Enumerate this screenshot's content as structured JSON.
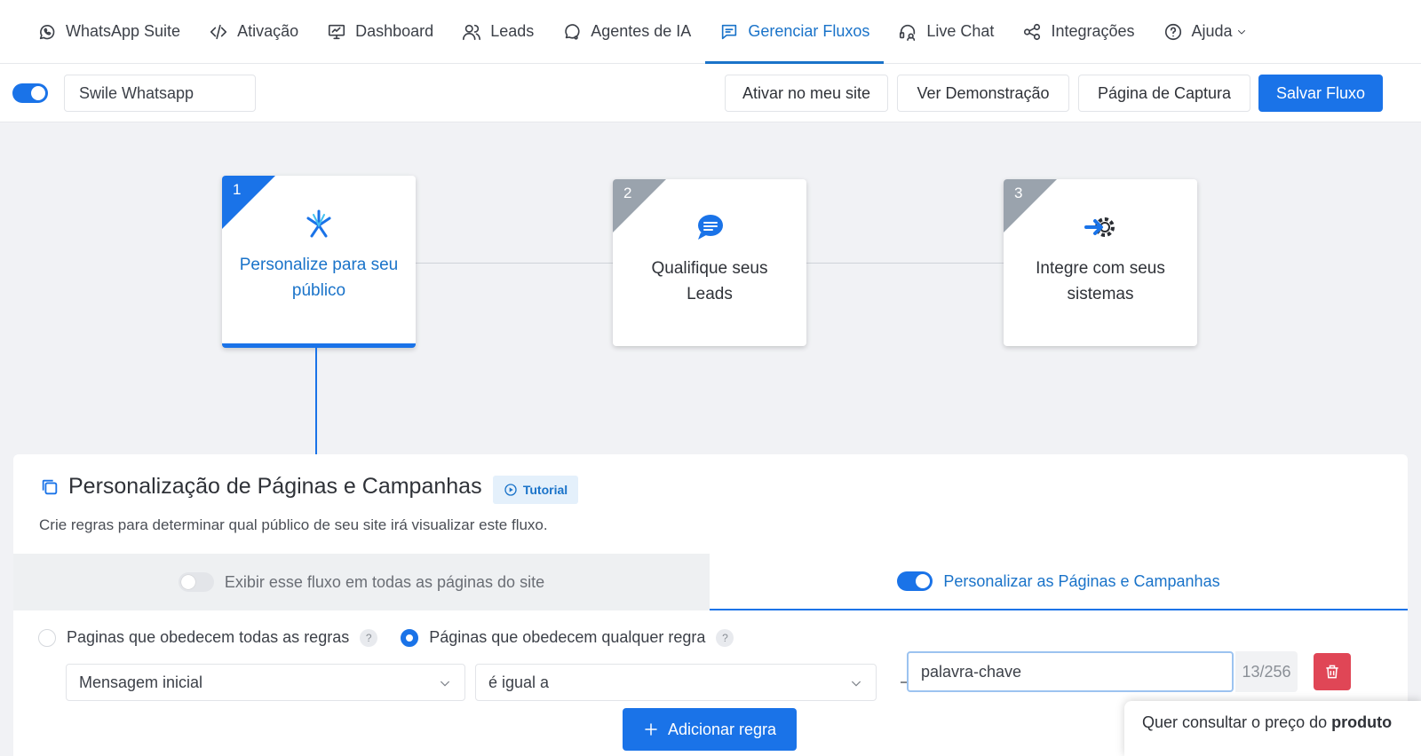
{
  "nav": {
    "items": [
      {
        "label": "WhatsApp Suite",
        "icon": "whatsapp-icon"
      },
      {
        "label": "Ativação",
        "icon": "code-icon"
      },
      {
        "label": "Dashboard",
        "icon": "monitor-icon"
      },
      {
        "label": "Leads",
        "icon": "users-icon"
      },
      {
        "label": "Agentes de IA",
        "icon": "chat-icon"
      },
      {
        "label": "Gerenciar Fluxos",
        "icon": "message-square-icon",
        "active": true
      },
      {
        "label": "Live Chat",
        "icon": "headset-icon"
      },
      {
        "label": "Integrações",
        "icon": "share-icon"
      },
      {
        "label": "Ajuda",
        "icon": "help-circle-icon"
      }
    ]
  },
  "toolbar": {
    "flow_name": "Swile Whatsapp",
    "activate_label": "Ativar no meu site",
    "demo_label": "Ver Demonstração",
    "capture_label": "Página de Captura",
    "save_label": "Salvar Fluxo"
  },
  "steps": [
    {
      "number": "1",
      "label": "Personalize para seu público",
      "active": true
    },
    {
      "number": "2",
      "label": "Qualifique seus Leads"
    },
    {
      "number": "3",
      "label": "Integre com seus sistemas"
    }
  ],
  "panel": {
    "title": "Personalização de Páginas e Campanhas",
    "tutorial_label": "Tutorial",
    "description": "Crie regras para determinar qual público de seu site irá visualizar este fluxo.",
    "tab_all": "Exibir esse fluxo em todas as páginas do site",
    "tab_custom": "Personalizar as Páginas e Campanhas",
    "radio_all": "Paginas que obedecem todas as regras",
    "radio_any": "Páginas que obedecem qualquer regra",
    "help": "?",
    "rule": {
      "field": "Mensagem inicial",
      "operator": "é igual a",
      "value": "palavra-chave",
      "counter": "13/256"
    },
    "add_rule_label": "Adicionar regra"
  },
  "chat_bubble": {
    "text": "Quer consultar o preço do ",
    "bold": "produto"
  },
  "colors": {
    "accent": "#1a73e8",
    "danger": "#e04656"
  }
}
